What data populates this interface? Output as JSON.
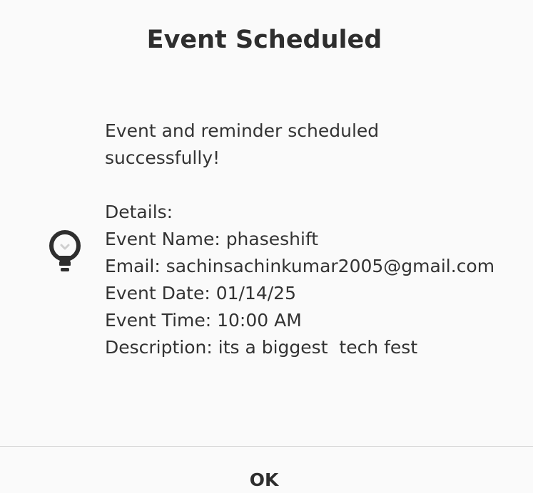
{
  "dialog": {
    "title": "Event Scheduled",
    "icon": "lightbulb-icon",
    "message": {
      "line1": "Event and reminder scheduled",
      "line2": "successfully!",
      "details_heading": "Details:",
      "event_name": "Event Name: phaseshift",
      "email": "Email: sachinsachinkumar2005@gmail.com",
      "event_date": "Event Date: 01/14/25",
      "event_time": "Event Time: 10:00 AM",
      "description": "Description: its a biggest  tech fest"
    },
    "ok_label": "OK"
  },
  "colors": {
    "background": "#fafafa",
    "text": "#2e2e2e",
    "divider": "#d6d6d6"
  }
}
